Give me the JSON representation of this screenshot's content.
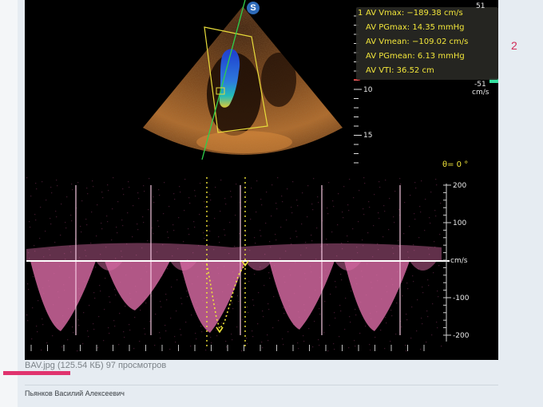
{
  "attachment": {
    "probe_badge": "S",
    "measurement_index": "1",
    "measurements": [
      "AV Vmax: −189.38 cm/s",
      "AV PGmax: 14.35  mmHg",
      "AV Vmean: −109.02 cm/s",
      "AV PGmean: 6.13  mmHg",
      "AV VTI: 36.52  cm"
    ],
    "color_scale": {
      "top": "51",
      "bottom": "-51",
      "unit": "cm/s"
    },
    "depth_ticks": [
      "10",
      "15"
    ],
    "angle": "θ= 0 °",
    "velocity_ticks": [
      "200",
      "100",
      "-100",
      "-200"
    ],
    "velocity_unit": "cm/s"
  },
  "page_number": "2",
  "caption": {
    "filename": "BAV.jpg",
    "meta": " (125.54 КБ) 97 просмотров"
  },
  "author": "Пьянков Василий Алексеевич",
  "colors": {
    "doppler_pink": "#d86aa4",
    "measure_yellow": "#f2e63a",
    "accent_red": "#e0336e"
  }
}
